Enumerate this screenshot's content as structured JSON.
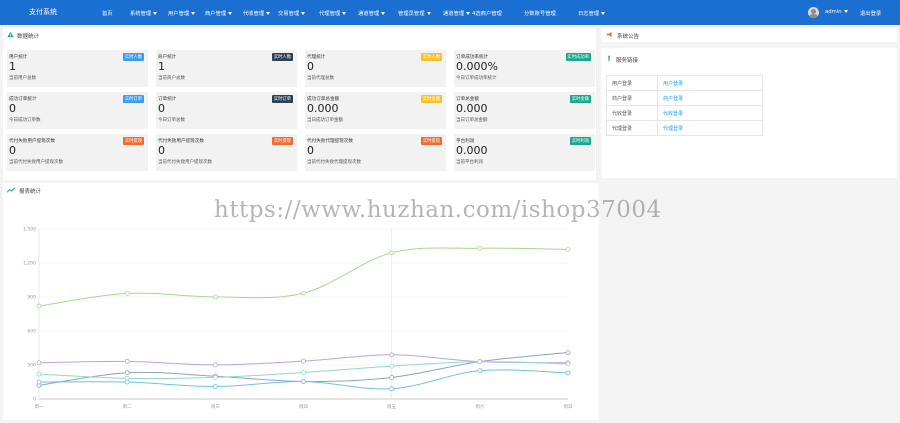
{
  "app": {
    "brand": "支付系统"
  },
  "nav": [
    {
      "label": "首页",
      "dropdown": false
    },
    {
      "label": "系统管理",
      "dropdown": true
    },
    {
      "label": "用户管理",
      "dropdown": true
    },
    {
      "label": "商户管理",
      "dropdown": true
    },
    {
      "label": "代收管理",
      "dropdown": true
    },
    {
      "label": "交易管理",
      "dropdown": true
    },
    {
      "label": "代理管理",
      "dropdown": true
    },
    {
      "label": "通道管理",
      "dropdown": true
    },
    {
      "label": "管理员管理",
      "dropdown": true
    },
    {
      "label": "通道管理",
      "dropdown": true
    },
    {
      "label": "4选商户管理",
      "dropdown": false
    },
    {
      "label": "分数账号管理",
      "dropdown": false
    },
    {
      "label": "日志管理",
      "dropdown": true
    }
  ],
  "user": {
    "name": "admin",
    "logout": "退出登录"
  },
  "stats_panel": {
    "title": "数据统计"
  },
  "stats": [
    {
      "title": "用户统计",
      "value": "1",
      "desc": "当前用户总数",
      "badge": "实时人数",
      "badge_color": "blue"
    },
    {
      "title": "商户统计",
      "value": "1",
      "desc": "当前商户总数",
      "badge": "实时人数",
      "badge_color": "dark"
    },
    {
      "title": "代理统计",
      "value": "0",
      "desc": "当前代理总数",
      "badge": "实时人数",
      "badge_color": "yellow"
    },
    {
      "title": "订单成功率统计",
      "value": "0.000%",
      "desc": "今日订单成功率统计",
      "badge": "实时成功率",
      "badge_color": "green"
    },
    {
      "title": "成功订单统计",
      "value": "0",
      "desc": "今日成功订单数",
      "badge": "实时订单",
      "badge_color": "blue"
    },
    {
      "title": "订单统计",
      "value": "0",
      "desc": "今日订单总数",
      "badge": "实时订单",
      "badge_color": "dark"
    },
    {
      "title": "成功订单总金额",
      "value": "0.000",
      "desc": "当日成功订单金额",
      "badge": "实时金额",
      "badge_color": "yellow"
    },
    {
      "title": "订单总金额",
      "value": "0.000",
      "desc": "当日订单总金额",
      "badge": "实时金额",
      "badge_color": "green"
    },
    {
      "title": "代付失败用户提现次数",
      "value": "0",
      "desc": "当前代付失败用户提现次数",
      "badge": "实时提现",
      "badge_color": "orange"
    },
    {
      "title": "代付失败用户提现次数",
      "value": "0",
      "desc": "当前代付失败用户提现次数",
      "badge": "实时提现",
      "badge_color": "orange"
    },
    {
      "title": "代付失败代理提现次数",
      "value": "0",
      "desc": "当前代付失败代理提现次数",
      "badge": "实时提现",
      "badge_color": "orange"
    },
    {
      "title": "平台利润",
      "value": "0.000",
      "desc": "当前平台利润",
      "badge": "实时利润",
      "badge_color": "green"
    }
  ],
  "notice_panel": {
    "title": "系统公告"
  },
  "quick_panel": {
    "title": "服务链接"
  },
  "links": [
    {
      "label": "用户登录",
      "link": "用户登录"
    },
    {
      "label": "商户登录",
      "link": "商户登录"
    },
    {
      "label": "代收登录",
      "link": "代收登录"
    },
    {
      "label": "代理登录",
      "link": "代理登录"
    }
  ],
  "chart_panel": {
    "title": "报表统计"
  },
  "watermark": "https://www.huzhan.com/ishop37004",
  "colors": {
    "topbar": "#1b6fd1",
    "badge_blue": "#3b9cf0",
    "badge_dark": "#2f4056",
    "badge_yellow": "#f7c12e",
    "badge_green": "#1aa88c",
    "badge_orange": "#ef6b2e",
    "link": "#1e9fff"
  },
  "chart_data": {
    "type": "line",
    "categories": [
      "周一",
      "周二",
      "周三",
      "周四",
      "周五",
      "周六",
      "周日"
    ],
    "ylim": [
      0,
      1500
    ],
    "yticks": [
      0,
      300,
      600,
      900,
      1200,
      1500
    ],
    "ytick_labels": [
      "0",
      "300",
      "600",
      "900",
      "1,200",
      "1,500"
    ],
    "grid": true,
    "series": [
      {
        "color": "#a5d98b",
        "values": [
          820,
          932,
          901,
          934,
          1290,
          1330,
          1320
        ]
      },
      {
        "color": "#b9a2e0",
        "values": [
          320,
          332,
          301,
          334,
          390,
          330,
          320
        ]
      },
      {
        "color": "#8fa3b6",
        "values": [
          120,
          232,
          201,
          154,
          190,
          330,
          410
        ]
      },
      {
        "color": "#91d9c4",
        "values": [
          220,
          182,
          191,
          234,
          290,
          330,
          310
        ]
      },
      {
        "color": "#6fc1e6",
        "values": [
          150,
          150,
          110,
          154,
          90,
          250,
          230
        ]
      }
    ]
  }
}
